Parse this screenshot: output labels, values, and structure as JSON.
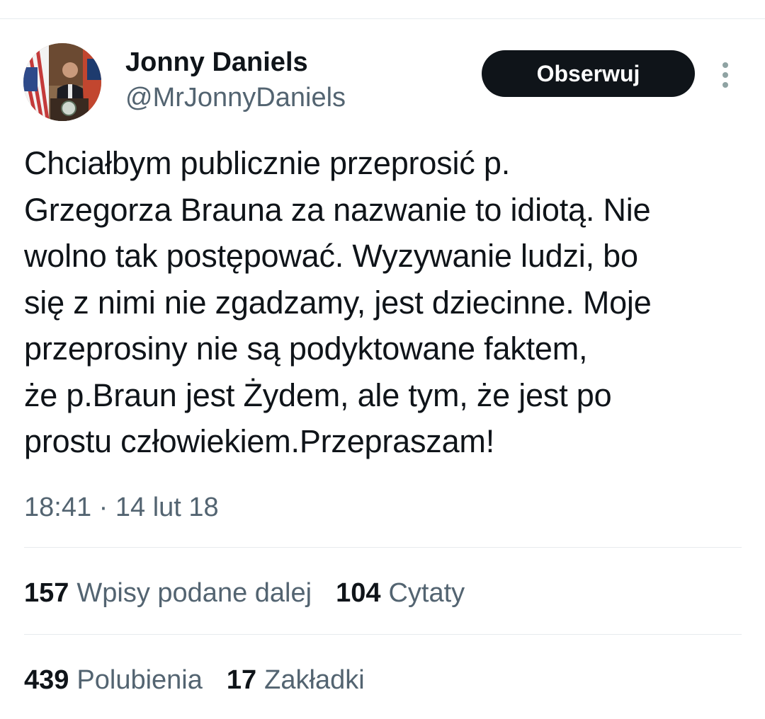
{
  "author": {
    "display_name": "Jonny Daniels",
    "handle": "@MrJonnyDaniels",
    "avatar_icon": "profile-photo"
  },
  "actions": {
    "follow_label": "Obserwuj",
    "more_icon": "more-vertical-icon"
  },
  "tweet": {
    "text": "Chciałbym publicznie przeprosić p.\nGrzegorza Brauna za nazwanie to idiotą. Nie\nwolno tak postępować. Wyzywanie ludzi, bo\nsię z nimi nie zgadzamy, jest dziecinne. Moje\nprzeprosiny nie są podyktowane faktem,\nże p.Braun jest Żydem, ale tym, że jest po\nprostu człowiekiem.Przepraszam!",
    "timestamp": "18:41 · 14 lut 18"
  },
  "stats": {
    "retweets": {
      "count": "157",
      "label": "Wpisy podane dalej"
    },
    "quotes": {
      "count": "104",
      "label": "Cytaty"
    },
    "likes": {
      "count": "439",
      "label": "Polubienia"
    },
    "bookmarks": {
      "count": "17",
      "label": "Zakładki"
    }
  },
  "colors": {
    "text_primary": "#0f1419",
    "text_secondary": "#536471",
    "divider": "#e7ebee",
    "button_bg": "#0f1419",
    "button_text": "#ffffff"
  }
}
